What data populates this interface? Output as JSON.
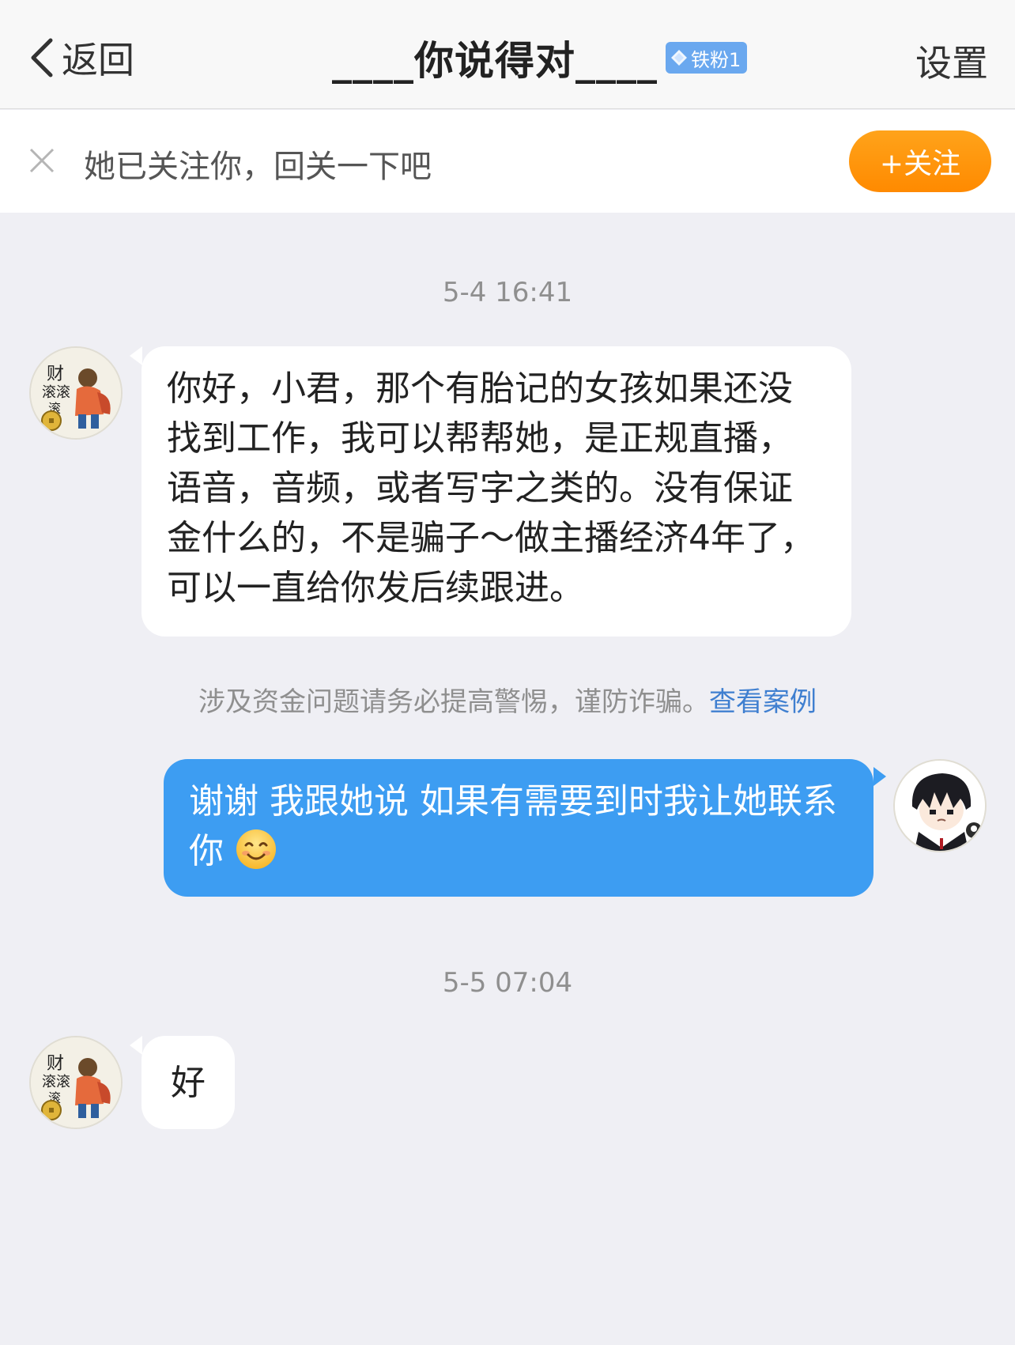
{
  "nav": {
    "back_label": "返回",
    "title": "____你说得对____",
    "fan_badge": "铁粉1",
    "settings_label": "设置"
  },
  "follow_bar": {
    "text": "她已关注你，回关一下吧",
    "button_label": "+关注"
  },
  "messages": [
    {
      "timestamp": "5-4 16:41"
    },
    {
      "direction": "incoming",
      "text": "你好，小君，那个有胎记的女孩如果还没找到工作，我可以帮帮她，是正规直播，语音，音频，或者写字之类的。没有保证金什么的，不是骗子～做主播经济4年了，可以一直给你发后续跟进。"
    },
    {
      "notice": "涉及资金问题请务必提高警惕，谨防诈骗。",
      "notice_link": "查看案例"
    },
    {
      "direction": "outgoing",
      "text": "谢谢 我跟她说 如果有需要到时我让她联系你",
      "emoji": "smiling-face-emoji"
    },
    {
      "timestamp": "5-5 07:04"
    },
    {
      "direction": "incoming",
      "text": "好"
    }
  ],
  "colors": {
    "background": "#efeff4",
    "outgoing_bubble": "#3d9df2",
    "follow_button": "#ff9a0e",
    "link": "#3f7fd0"
  }
}
